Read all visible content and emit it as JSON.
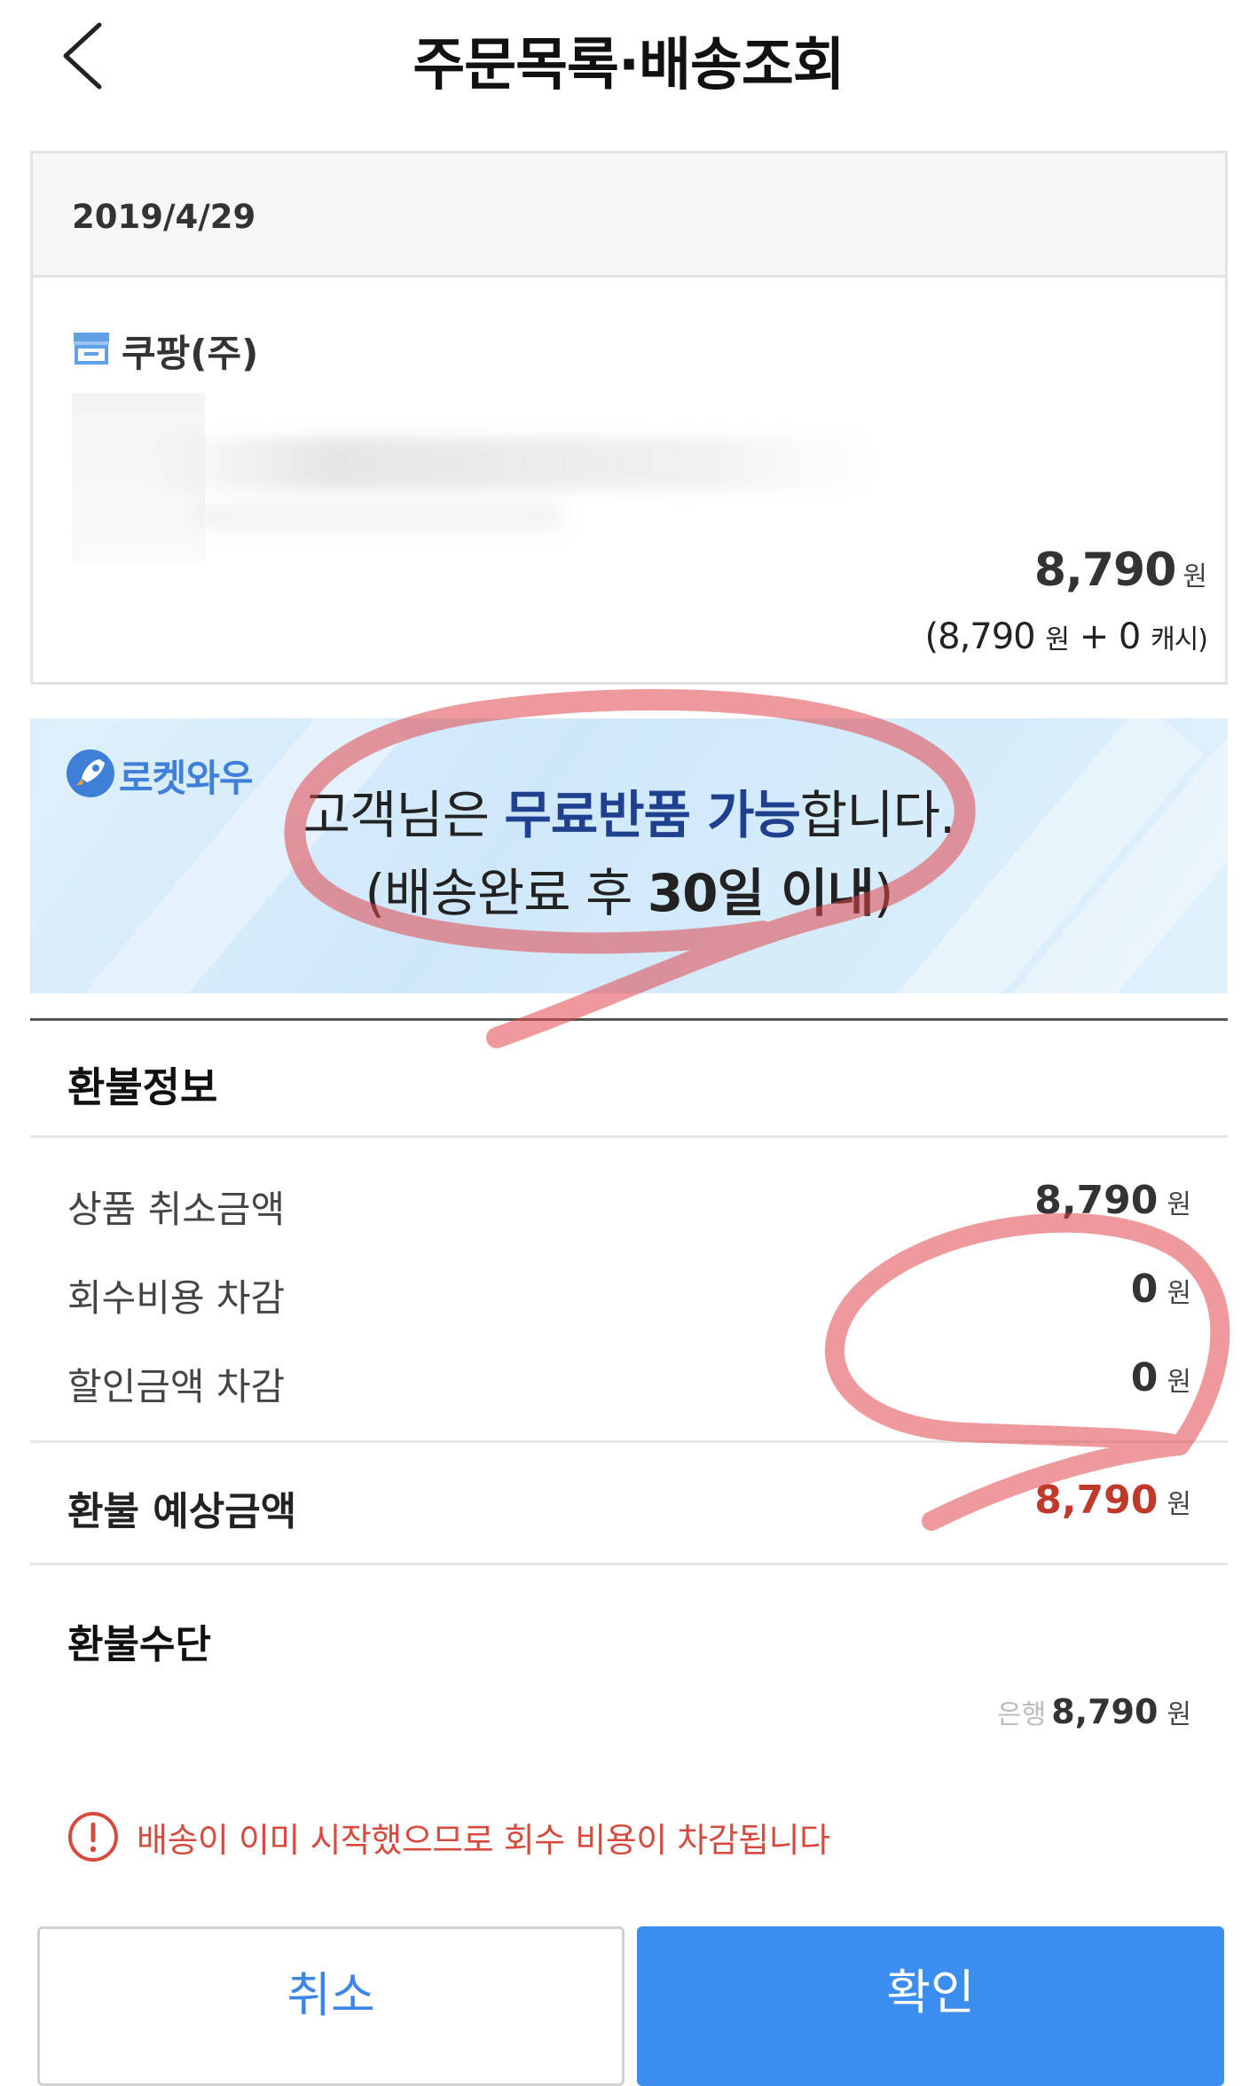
{
  "header": {
    "title": "주문목록·배송조회"
  },
  "order": {
    "date": "2019/4/29",
    "seller": "쿠팡(주)",
    "price": "8,790",
    "price_unit": "원",
    "breakdown": {
      "open": "(8,790",
      "won_unit": "원",
      "plus_cash": "+ 0",
      "cash_unit": "캐시)"
    }
  },
  "banner": {
    "brand": "로켓와우",
    "line1_pre": "고객님은 ",
    "line1_highlight": "무료반품 가능",
    "line1_post": "합니다.",
    "line2_pre": "(배송완료 후 ",
    "line2_bold": "30일 이내",
    "line2_post": ")"
  },
  "refund": {
    "title": "환불정보",
    "rows": [
      {
        "label": "상품 취소금액",
        "value": "8,790",
        "unit": "원"
      },
      {
        "label": "회수비용 차감",
        "value": "0",
        "unit": "원"
      },
      {
        "label": "할인금액 차감",
        "value": "0",
        "unit": "원"
      }
    ],
    "expected": {
      "label": "환불 예상금액",
      "value": "8,790",
      "unit": "원"
    },
    "method_title": "환불수단",
    "method": {
      "prefix": "은행",
      "value": "8,790",
      "unit": "원"
    },
    "warning": "배송이 이미 시작했으므로 회수 비용이 차감됩니다"
  },
  "buttons": {
    "cancel": "취소",
    "confirm": "확인"
  },
  "colors": {
    "accent_blue": "#3b8ef0",
    "warning_red": "#d64b3e",
    "refund_red": "#c0392b",
    "annotation_red": "#e0454b"
  }
}
